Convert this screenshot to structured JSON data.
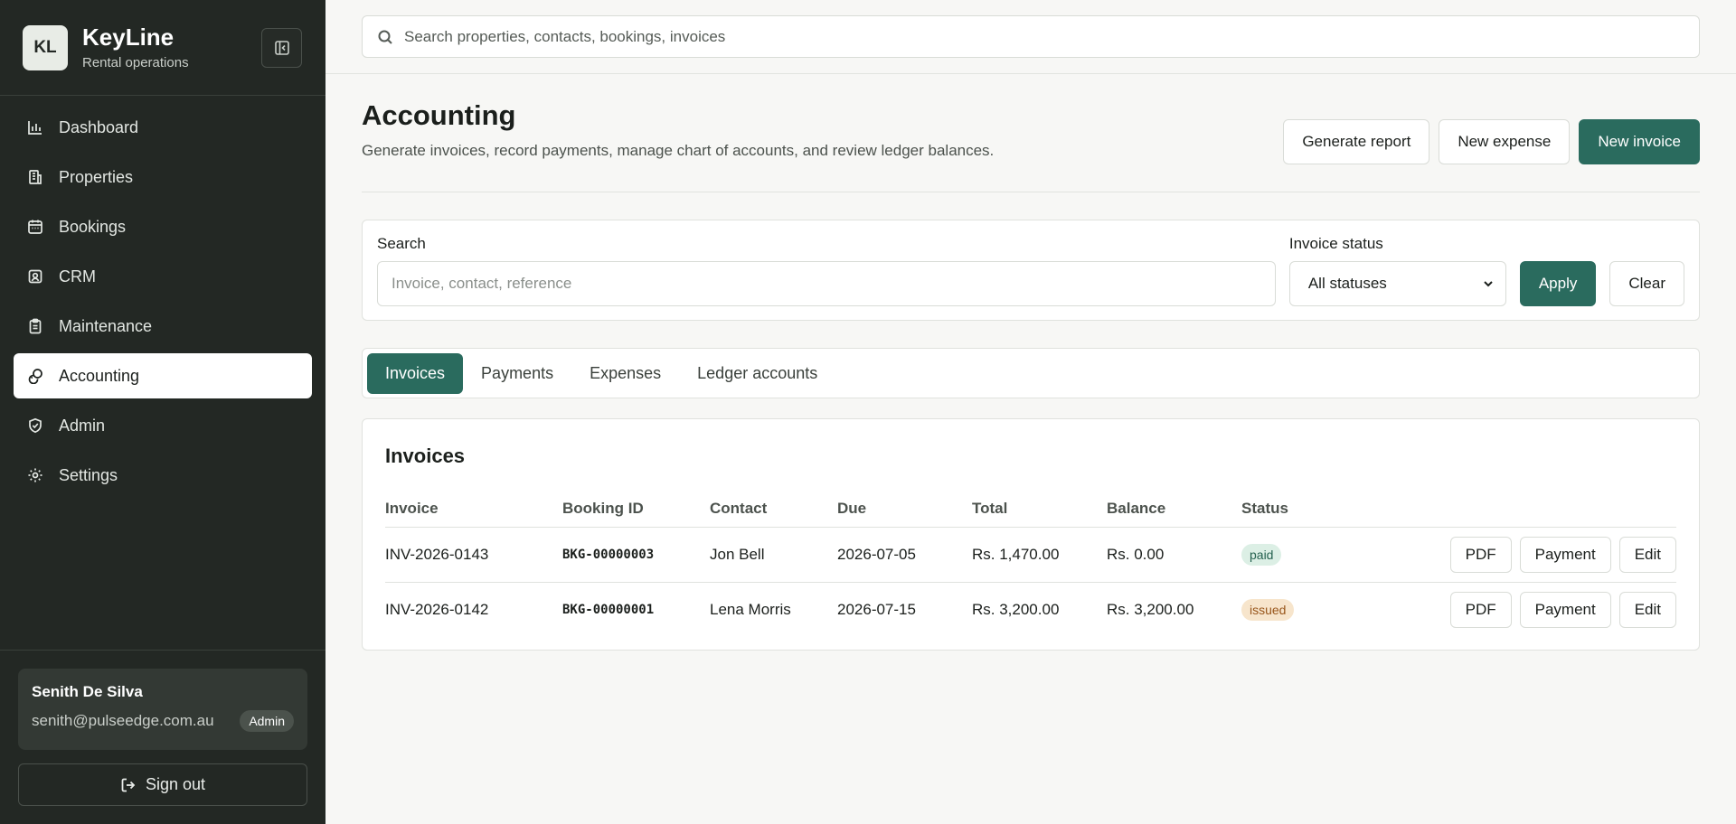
{
  "brand": {
    "logo": "KL",
    "name": "KeyLine",
    "subtitle": "Rental operations"
  },
  "sidebar": {
    "items": [
      {
        "label": "Dashboard",
        "icon": "bar-chart-icon"
      },
      {
        "label": "Properties",
        "icon": "building-icon"
      },
      {
        "label": "Bookings",
        "icon": "calendar-icon"
      },
      {
        "label": "CRM",
        "icon": "contact-icon"
      },
      {
        "label": "Maintenance",
        "icon": "clipboard-icon"
      },
      {
        "label": "Accounting",
        "icon": "coins-icon",
        "active": true
      },
      {
        "label": "Admin",
        "icon": "shield-icon"
      },
      {
        "label": "Settings",
        "icon": "gear-icon"
      }
    ],
    "user": {
      "name": "Senith De Silva",
      "email": "senith@pulseedge.com.au",
      "role": "Admin"
    },
    "signout_label": "Sign out"
  },
  "topbar": {
    "search_placeholder": "Search properties, contacts, bookings, invoices"
  },
  "page": {
    "title": "Accounting",
    "description": "Generate invoices, record payments, manage chart of accounts, and review ledger balances.",
    "actions": {
      "report": "Generate report",
      "expense": "New expense",
      "invoice": "New invoice"
    }
  },
  "filters": {
    "search_label": "Search",
    "search_placeholder": "Invoice, contact, reference",
    "status_label": "Invoice status",
    "status_value": "All statuses",
    "apply_label": "Apply",
    "clear_label": "Clear"
  },
  "tabs": [
    "Invoices",
    "Payments",
    "Expenses",
    "Ledger accounts"
  ],
  "invoices": {
    "title": "Invoices",
    "columns": [
      "Invoice",
      "Booking ID",
      "Contact",
      "Due",
      "Total",
      "Balance",
      "Status"
    ],
    "rows": [
      {
        "invoice": "INV-2026-0143",
        "booking": "BKG-00000003",
        "contact": "Jon Bell",
        "due": "2026-07-05",
        "total": "Rs. 1,470.00",
        "balance": "Rs. 0.00",
        "status": "paid"
      },
      {
        "invoice": "INV-2026-0142",
        "booking": "BKG-00000001",
        "contact": "Lena Morris",
        "due": "2026-07-15",
        "total": "Rs. 3,200.00",
        "balance": "Rs. 3,200.00",
        "status": "issued"
      }
    ],
    "row_actions": {
      "pdf": "PDF",
      "payment": "Payment",
      "edit": "Edit"
    }
  },
  "colors": {
    "accent": "#2a6b5e",
    "sidebar_bg": "#232824",
    "paid_bg": "#dcefe5",
    "issued_bg": "#f7e5cc"
  }
}
